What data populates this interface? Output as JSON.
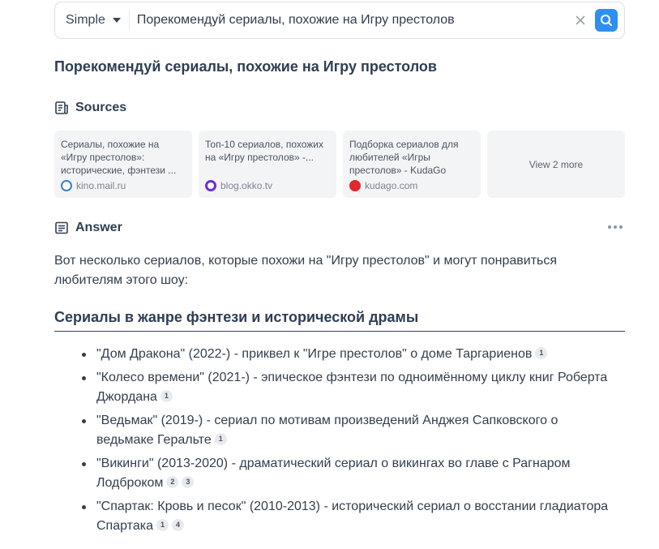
{
  "search": {
    "mode": "Simple",
    "query": "Порекомендуй сериалы, похожие на Игру престолов"
  },
  "title": "Порекомендуй сериалы, похожие на Игру престолов",
  "sources": {
    "heading": "Sources",
    "items": [
      {
        "title": "Сериалы, похожие на «Игру престолов»: исторические, фэнтези ...",
        "domain": "kino.mail.ru",
        "icon": "kino-mail-favicon",
        "color": "#3b82c4"
      },
      {
        "title": "Топ-10 сериалов, похожих на «Игру престолов» -...",
        "domain": "blog.okko.tv",
        "icon": "okko-favicon",
        "color": "#6b2fd6"
      },
      {
        "title": "Подборка сериалов для любителей «Игры престолов» - KudaGo",
        "domain": "kudago.com",
        "icon": "kudago-favicon",
        "color": "#e0282e"
      }
    ],
    "more_label": "View 2 more"
  },
  "answer": {
    "heading": "Answer",
    "intro": "Вот несколько сериалов, которые похожи на \"Игру престолов\" и могут понравиться любителям этого шоу:",
    "subheading": "Сериалы в жанре фэнтези и исторической драмы",
    "items": [
      {
        "text": "\"Дом Дракона\" (2022-) - приквел к \"Игре престолов\" о доме Таргариенов",
        "cites": [
          "1"
        ]
      },
      {
        "text": "\"Колесо времени\" (2021-) - эпическое фэнтези по одноимённому циклу книг Роберта Джордана",
        "cites": [
          "1"
        ]
      },
      {
        "text": "\"Ведьмак\" (2019-) - сериал по мотивам произведений Анджея Сапковского о ведьмаке Геральте",
        "cites": [
          "1"
        ]
      },
      {
        "text": "\"Викинги\" (2013-2020) - драматический сериал о викингах во главе с Рагнаром Лодброком",
        "cites": [
          "2",
          "3"
        ]
      },
      {
        "text": "\"Спартак: Кровь и песок\" (2010-2013) - исторический сериал о восстании гладиатора Спартака",
        "cites": [
          "1",
          "4"
        ]
      }
    ]
  }
}
